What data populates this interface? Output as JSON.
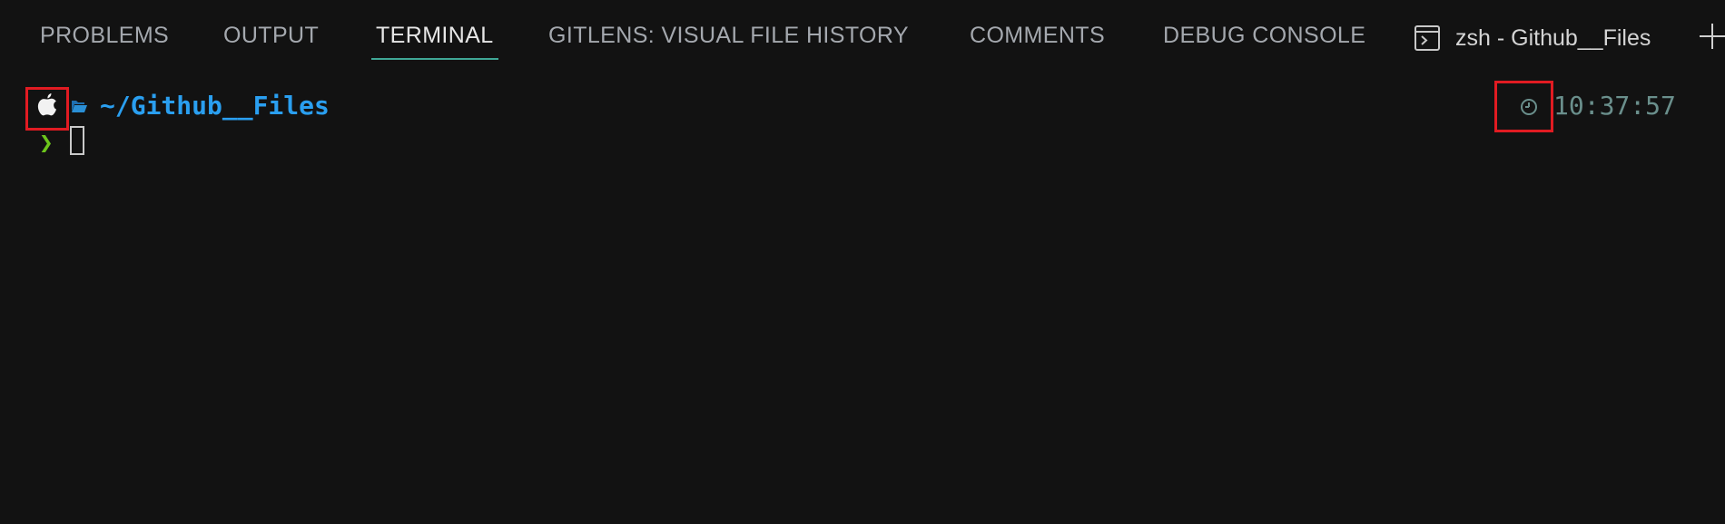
{
  "panel": {
    "tabs": [
      {
        "label": "PROBLEMS",
        "active": false
      },
      {
        "label": "OUTPUT",
        "active": false
      },
      {
        "label": "TERMINAL",
        "active": true
      },
      {
        "label": "GITLENS: VISUAL FILE HISTORY",
        "active": false
      },
      {
        "label": "COMMENTS",
        "active": false
      },
      {
        "label": "DEBUG CONSOLE",
        "active": false
      }
    ],
    "terminal_selector": {
      "label": "zsh - Github__Files",
      "icon": "terminal-icon"
    },
    "add_icon": "plus-icon"
  },
  "terminal": {
    "os_icon": "apple-icon",
    "folder_icon": "folder-open-icon",
    "path": "~/Github__Files",
    "prompt_symbol": "❯",
    "clock_icon": "clock-icon",
    "time": "10:37:57"
  },
  "colors": {
    "background": "#121212",
    "tab_active": "#e6e6e6",
    "tab_inactive": "#a4a8ae",
    "tab_underline": "#3fa796",
    "path": "#2a9ff0",
    "prompt": "#6cc51c",
    "time": "#6a8f8c",
    "highlight_box": "#e11b22"
  }
}
